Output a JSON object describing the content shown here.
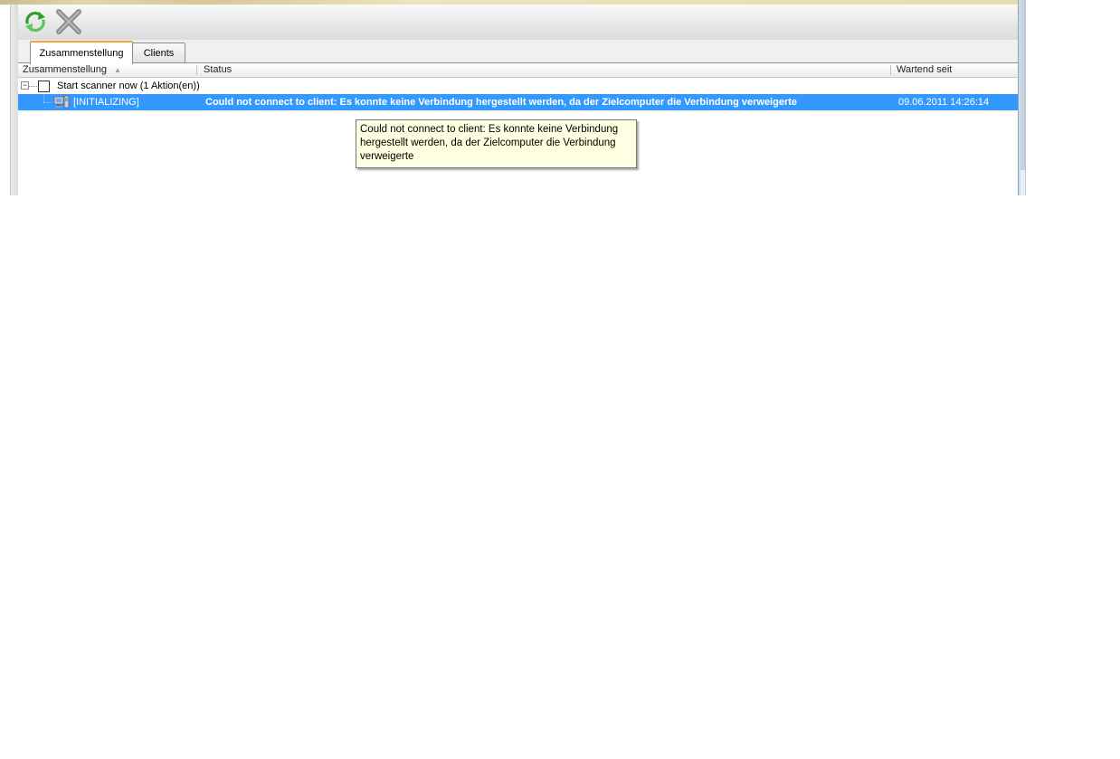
{
  "toolbar": {
    "refresh_icon": "refresh-icon",
    "cancel_icon": "close-x-icon"
  },
  "tabs": [
    {
      "label": "Zusammenstellung",
      "active": true
    },
    {
      "label": "Clients",
      "active": false
    }
  ],
  "columns": {
    "c1": "Zusammenstellung",
    "c2": "Status",
    "c3": "Wartend seit",
    "sort_indicator": "▲"
  },
  "rows": [
    {
      "expander": "−",
      "label": "Start scanner now (1 Aktion(en))",
      "status": "",
      "since": ""
    },
    {
      "label": "[INITIALIZING]",
      "status": "Could not connect to client: Es konnte keine Verbindung hergestellt werden, da der Zielcomputer die Verbindung verweigerte",
      "since": "09.06.2011 14:26:14",
      "selected": true
    }
  ],
  "tooltip": {
    "text": "Could not connect to client: Es konnte keine Verbindung hergestellt werden, da der Zielcomputer die Verbindung verweigerte"
  },
  "colors": {
    "selection": "#3399ff",
    "tooltip_bg": "#ffffe1",
    "tab_accent": "#f2a63a"
  }
}
